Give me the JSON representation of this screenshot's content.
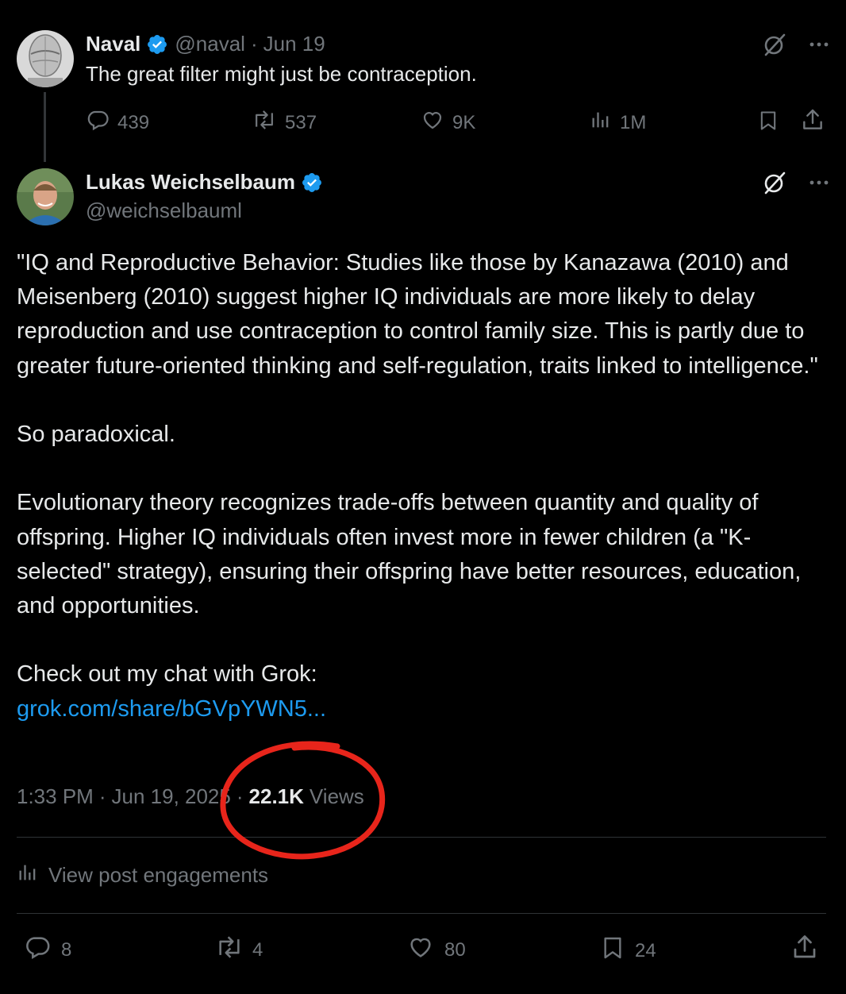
{
  "parent_tweet": {
    "author_name": "Naval",
    "author_handle": "@naval",
    "date": "Jun 19",
    "text": "The great filter might just be contraception.",
    "replies": "439",
    "reposts": "537",
    "likes": "9K",
    "views": "1M"
  },
  "main_tweet": {
    "author_name": "Lukas Weichselbaum",
    "author_handle": "@weichselbauml",
    "paragraphs": [
      "\"IQ and Reproductive Behavior: Studies like those by Kanazawa (2010) and Meisenberg (2010) suggest higher IQ individuals are more likely to delay reproduction and use contraception to control family size. This is partly due to greater future-oriented thinking and self-regulation, traits linked to intelligence.\"",
      "So paradoxical.",
      "Evolutionary theory recognizes trade-offs between quantity and quality of offspring. Higher IQ individuals often invest more in fewer children (a \"K-selected\" strategy), ensuring their offspring have better resources, education, and opportunities."
    ],
    "cta": "Check out my chat with Grok:",
    "link": "grok.com/share/bGVpYWN5...",
    "time": "1:33 PM",
    "date": "Jun 19, 2025",
    "views_count": "22.1K",
    "views_label": "Views",
    "engagements_label": "View post engagements",
    "replies": "8",
    "reposts": "4",
    "likes": "80",
    "bookmarks": "24"
  },
  "icons": {
    "verified": "verified-badge-icon",
    "grok": "grok-icon",
    "more": "more-icon",
    "reply": "reply-icon",
    "repost": "repost-icon",
    "like": "like-icon",
    "views": "analytics-icon",
    "bookmark": "bookmark-icon",
    "share": "share-icon"
  },
  "colors": {
    "background": "#000000",
    "text": "#e7e9ea",
    "muted": "#71767b",
    "link": "#1d9bf0",
    "verified": "#1d9bf0",
    "annotation": "#e8251b"
  }
}
